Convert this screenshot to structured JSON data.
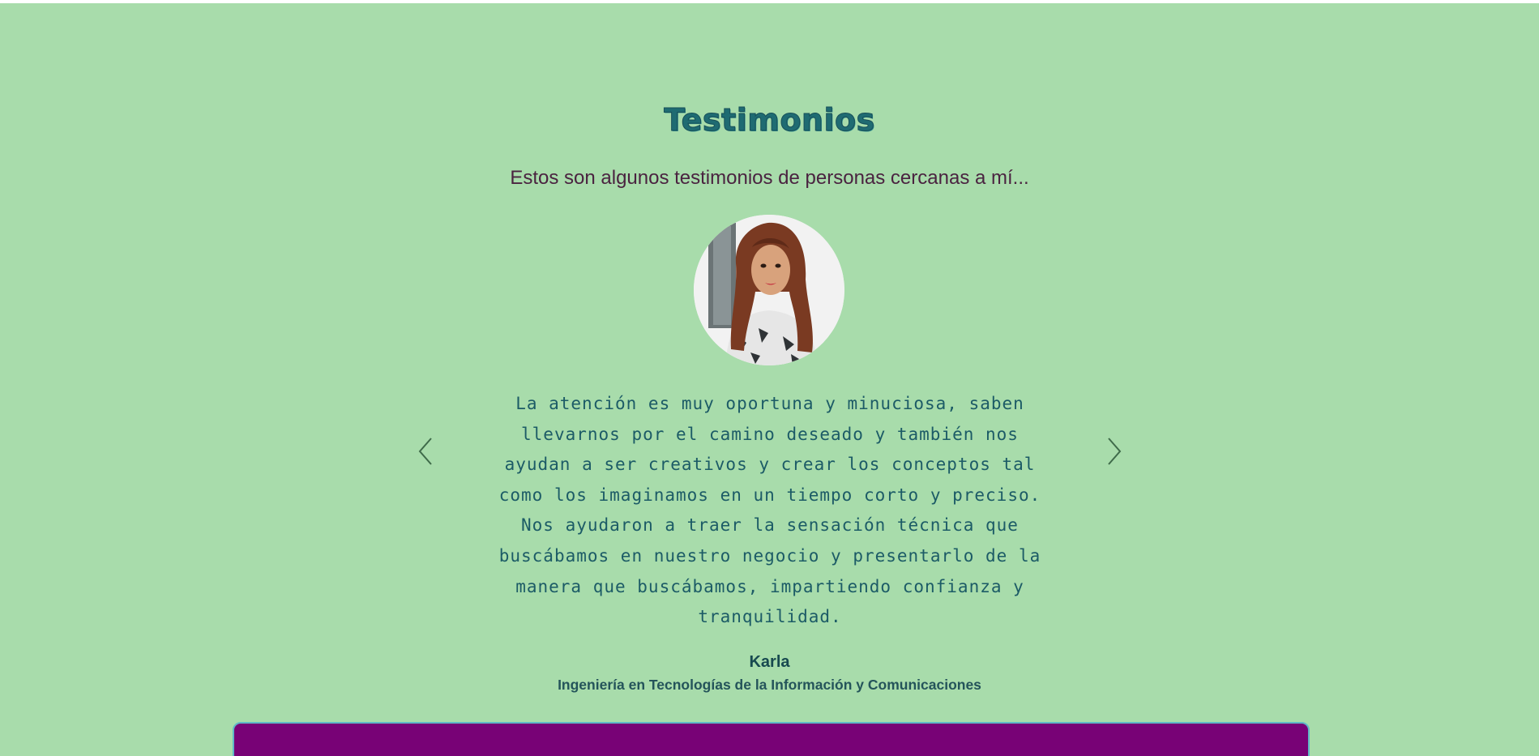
{
  "section": {
    "title": "Testimonios",
    "subtitle": "Estos son algunos testimonios de personas cercanas a mí..."
  },
  "testimonial": {
    "avatar_icon": "person-photo-avatar",
    "quote": "La atención es muy oportuna y minuciosa, saben llevarnos por el camino deseado y también nos ayudan a ser creativos y crear los conceptos tal como los imaginamos en un tiempo corto y preciso. Nos ayudaron a traer la sensación técnica que buscábamos en nuestro negocio y presentarlo de la manera que buscábamos, impartiendo confianza y tranquilidad.",
    "author": "Karla",
    "role": "Ingeniería en Tecnologías de la Información y Comunicaciones"
  },
  "controls": {
    "prev_icon": "chevron-left-icon",
    "next_icon": "chevron-right-icon"
  },
  "colors": {
    "background": "#a8dcab",
    "title": "#1f6b72",
    "subtitle": "#4a2340",
    "quote": "#1c5b66",
    "panel": "#780276",
    "panel_border": "#5fb7c6"
  }
}
